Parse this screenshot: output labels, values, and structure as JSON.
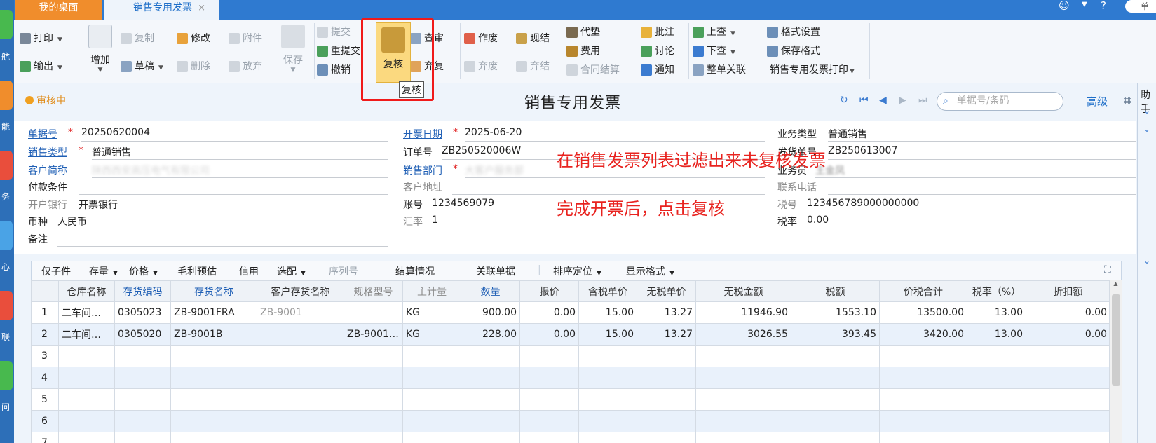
{
  "tabs": {
    "home": "我的桌面",
    "active": "销售专用发票",
    "close": "×"
  },
  "topbar": {
    "search_placeholder": "单"
  },
  "left_strip": {
    "labels": [
      "航",
      "能",
      "务",
      "心",
      "联",
      "问"
    ]
  },
  "ribbon": {
    "print": "打印",
    "export": "输出",
    "add": "增加",
    "copy": "复制",
    "modify": "修改",
    "attach": "附件",
    "draft": "草稿",
    "delete": "删除",
    "abandon": "放弃",
    "save": "保存",
    "submit": "提交",
    "resubmit": "重提交",
    "withdraw": "撤销",
    "review": "复核",
    "audit": "查审",
    "unreview": "弃复",
    "void": "作废",
    "unvoid": "弃废",
    "cashsettle": "现结",
    "uncashsettle": "弃结",
    "advance": "代垫",
    "expense": "费用",
    "contract_settle": "合同结算",
    "annotate": "批注",
    "discuss": "讨论",
    "notify": "通知",
    "prev_query": "上查",
    "next_query": "下查",
    "link_all": "整单关联",
    "format_settings": "格式设置",
    "save_format": "保存格式",
    "print_template": "销售专用发票打印",
    "tooltip": "复核"
  },
  "header": {
    "status": "审核中",
    "title": "销售专用发票",
    "search_placeholder": "单据号/条码",
    "advanced": "高级"
  },
  "side_panel": {
    "title": "助手"
  },
  "form": {
    "doc_no_label": "单据号",
    "doc_no": "20250620004",
    "invoice_date_label": "开票日期",
    "invoice_date": "2025-06-20",
    "biz_type_label": "业务类型",
    "biz_type": "普通销售",
    "sales_type_label": "销售类型",
    "sales_type": "普通销售",
    "order_no_label": "订单号",
    "order_no": "ZB250520006W",
    "ship_no_label": "发货单号",
    "ship_no": "ZB250613007",
    "customer_label": "客户简称",
    "customer": "陕西西安高压电气有限公司",
    "dept_label": "销售部门",
    "dept": "大客户服务部",
    "salesman_label": "业务员",
    "salesman": "王金凤",
    "pay_terms_label": "付款条件",
    "cust_addr_label": "客户地址",
    "phone_label": "联系电话",
    "bank_label": "开户银行",
    "bank": "开票银行",
    "account_label": "账号",
    "account": "1234569079",
    "tax_no_label": "税号",
    "tax_no": "123456789000000000",
    "currency_label": "币种",
    "currency": "人民币",
    "rate_label": "汇率",
    "rate": "1",
    "tax_rate_label": "税率",
    "tax_rate": "0.00",
    "remark_label": "备注"
  },
  "annotations": {
    "line1": "在销售发票列表过滤出来未复核发票",
    "line2": "完成开票后，点击复核"
  },
  "grid_toolbar": {
    "items": [
      "仅子件",
      "存量",
      "价格",
      "毛利预估",
      "信用",
      "选配",
      "序列号",
      "结算情况",
      "关联单据",
      "排序定位",
      "显示格式"
    ]
  },
  "table": {
    "columns": [
      "",
      "仓库名称",
      "存货编码",
      "存货名称",
      "客户存货名称",
      "规格型号",
      "主计量",
      "数量",
      "报价",
      "含税单价",
      "无税单价",
      "无税金额",
      "税额",
      "价税合计",
      "税率（%）",
      "折扣额"
    ],
    "rows": [
      [
        "1",
        "二车间…",
        "0305023",
        "ZB-9001FRA",
        "ZB-9001",
        "",
        "KG",
        "900.00",
        "0.00",
        "15.00",
        "13.27",
        "11946.90",
        "1553.10",
        "13500.00",
        "13.00",
        "0.00"
      ],
      [
        "2",
        "二车间…",
        "0305020",
        "ZB-9001B",
        "",
        "ZB-9001…",
        "KG",
        "228.00",
        "0.00",
        "15.00",
        "13.27",
        "3026.55",
        "393.45",
        "3420.00",
        "13.00",
        "0.00"
      ],
      [
        "3",
        "",
        "",
        "",
        "",
        "",
        "",
        "",
        "",
        "",
        "",
        "",
        "",
        "",
        "",
        ""
      ],
      [
        "4",
        "",
        "",
        "",
        "",
        "",
        "",
        "",
        "",
        "",
        "",
        "",
        "",
        "",
        "",
        ""
      ],
      [
        "5",
        "",
        "",
        "",
        "",
        "",
        "",
        "",
        "",
        "",
        "",
        "",
        "",
        "",
        "",
        ""
      ],
      [
        "6",
        "",
        "",
        "",
        "",
        "",
        "",
        "",
        "",
        "",
        "",
        "",
        "",
        "",
        "",
        ""
      ],
      [
        "7",
        "",
        "",
        "",
        "",
        "",
        "",
        "",
        "",
        "",
        "",
        "",
        "",
        "",
        "",
        ""
      ]
    ]
  },
  "colors": {
    "tab_bar": "#2f7ad0",
    "home_tab": "#f08d2c",
    "highlight": "#f01a1a",
    "annotation": "#e8231f",
    "link": "#1f5fb5",
    "status": "#e08a15"
  }
}
